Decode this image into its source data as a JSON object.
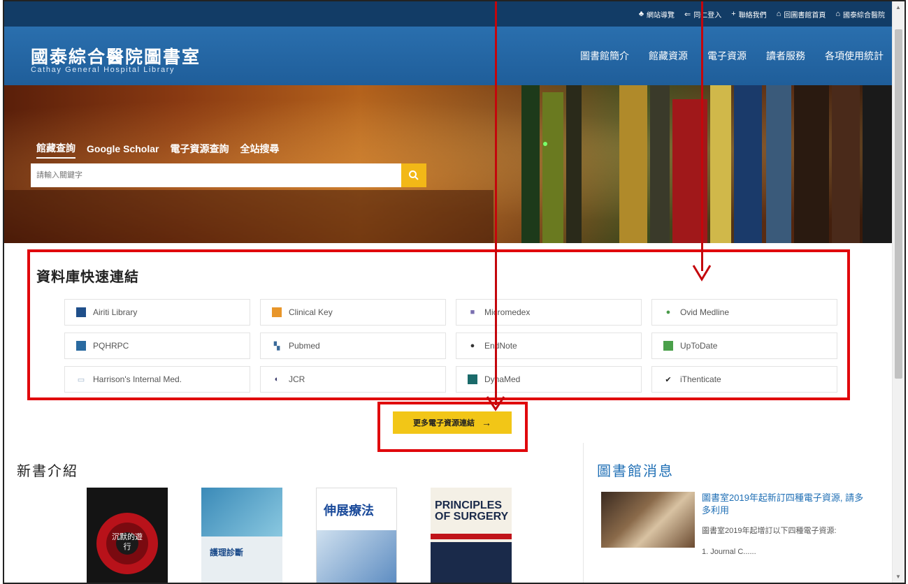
{
  "topbar": {
    "links": [
      {
        "icon": "sitemap-icon",
        "label": "網站導覽"
      },
      {
        "icon": "login-icon",
        "label": "同仁登入"
      },
      {
        "icon": "plus-icon",
        "label": "聯絡我們"
      },
      {
        "icon": "home-icon",
        "label": "回圖書館首頁"
      },
      {
        "icon": "home-icon",
        "label": "國泰綜合醫院"
      }
    ]
  },
  "header": {
    "title_zh": "國泰綜合醫院圖書室",
    "title_en": "Cathay General Hospital Library",
    "nav": [
      "圖書館簡介",
      "館藏資源",
      "電子資源",
      "讀者服務",
      "各項使用統計"
    ]
  },
  "hero": {
    "tabs": [
      "館藏查詢",
      "Google Scholar",
      "電子資源查詢",
      "全站搜尋"
    ],
    "active_tab": "館藏查詢",
    "search_placeholder": "請輸入關鍵字"
  },
  "quick_links": {
    "title": "資料庫快速連結",
    "items": [
      {
        "label": "Airiti Library",
        "icon": "airiti-icon",
        "color": "#1f4f8a"
      },
      {
        "label": "Clinical Key",
        "icon": "clinicalkey-icon",
        "color": "#e8962a"
      },
      {
        "label": "Micromedex",
        "icon": "micromedex-icon",
        "color": "#7a6fb0"
      },
      {
        "label": "Ovid Medline",
        "icon": "ovid-icon",
        "color": "#4a9a4a"
      },
      {
        "label": "PQHRPC",
        "icon": "pqhrpc-icon",
        "color": "#2a6aa0"
      },
      {
        "label": "Pubmed",
        "icon": "pubmed-icon",
        "color": "#3a6a9a"
      },
      {
        "label": "EndNote",
        "icon": "endnote-icon",
        "color": "#333333"
      },
      {
        "label": "UpToDate",
        "icon": "uptodate-icon",
        "color": "#4aa04a"
      },
      {
        "label": "Harrison's Internal Med.",
        "icon": "harrison-icon",
        "color": "#9ab0c8"
      },
      {
        "label": "JCR",
        "icon": "jcr-icon",
        "color": "#3a3a6a"
      },
      {
        "label": "DynaMed",
        "icon": "dynamed-icon",
        "color": "#1a6a6a"
      },
      {
        "label": "iThenticate",
        "icon": "check-icon",
        "color": "#222222"
      }
    ]
  },
  "more_button": {
    "label": "更多電子資源連結",
    "icon": "arrow-right-icon"
  },
  "new_books": {
    "title": "新書介紹",
    "covers": [
      {
        "text": "沉默的遊行",
        "bg": "#1a1a1a",
        "accent": "#c0141a"
      },
      {
        "text": "護理診斷",
        "bg": "#3a8ab8",
        "accent": "#ffffff"
      },
      {
        "text": "伸展療法",
        "bg": "#ffffff",
        "accent": "#1a4a9a"
      },
      {
        "text": "PRINCIPLES OF SURGERY",
        "bg": "#f4f0e6",
        "accent": "#1a2a4a"
      }
    ]
  },
  "news": {
    "title": "圖書館消息",
    "headline": "圖書室2019年起新訂四種電子資源, 請多多利用",
    "body": "圖書室2019年起增訂以下四種電子資源:",
    "body2": "1. Journal C......"
  }
}
